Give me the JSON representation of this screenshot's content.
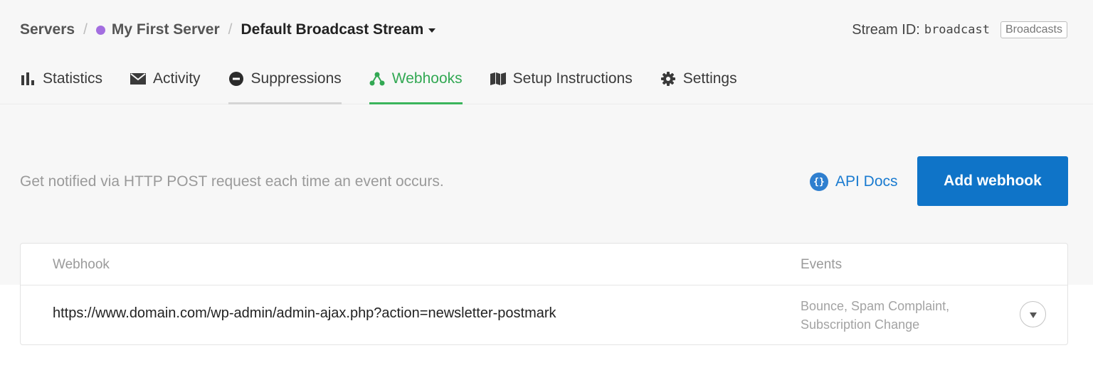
{
  "breadcrumb": {
    "servers": "Servers",
    "separator": "/",
    "server_name": "My First Server",
    "server_color": "#a36ee0",
    "stream_name": "Default Broadcast Stream"
  },
  "stream": {
    "id_label": "Stream ID:",
    "id_value": "broadcast",
    "badge": "Broadcasts"
  },
  "tabs": [
    {
      "label": "Statistics",
      "icon": "bar-chart-icon"
    },
    {
      "label": "Activity",
      "icon": "envelope-icon"
    },
    {
      "label": "Suppressions",
      "icon": "minus-circle-icon"
    },
    {
      "label": "Webhooks",
      "icon": "webhook-icon",
      "active": true
    },
    {
      "label": "Setup Instructions",
      "icon": "map-icon"
    },
    {
      "label": "Settings",
      "icon": "gear-icon"
    }
  ],
  "intro": {
    "text": "Get notified via HTTP POST request each time an event occurs.",
    "api_docs_icon_text": "{}",
    "api_docs_label": "API Docs",
    "add_button": "Add webhook"
  },
  "table": {
    "headers": {
      "webhook": "Webhook",
      "events": "Events"
    },
    "rows": [
      {
        "url": "https://www.domain.com/wp-admin/admin-ajax.php?action=newsletter-postmark",
        "events_line1": "Bounce, Spam Complaint,",
        "events_line2": "Subscription Change"
      }
    ]
  },
  "colors": {
    "accent_green": "#3bb55c",
    "primary_blue": "#0f74c8",
    "link_blue": "#1a7bd0"
  }
}
